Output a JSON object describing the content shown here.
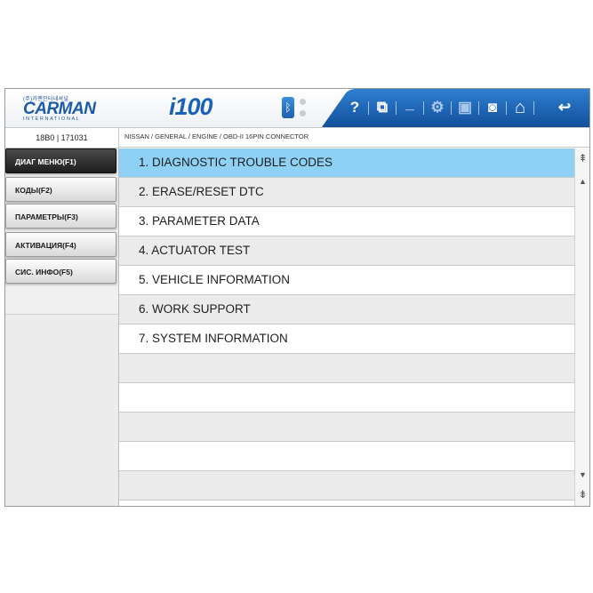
{
  "brand": {
    "korean": "(주)카맨인터내셔널",
    "name": "CARMAN",
    "sub": "INTERNATIONAL"
  },
  "model": "i100",
  "toolbar": {
    "help": "?",
    "window": "⧉",
    "minimize": "_",
    "settings": "⚙",
    "save": "▣",
    "camera": "◙",
    "home": "⌂",
    "back": "↩"
  },
  "status": {
    "vin": "18B0  |   171031",
    "path": "NISSAN / GENERAL / ENGINE / OBD-II 16PIN CONNECTOR"
  },
  "sidebar": {
    "items": [
      {
        "label": "ДИАГ МЕНЮ(F1)",
        "active": true
      },
      {
        "label": "КОДЫ(F2)",
        "active": false
      },
      {
        "label": "ПАРАМЕТРЫ(F3)",
        "active": false
      },
      {
        "label": "АКТИВАЦИЯ(F4)",
        "active": false
      },
      {
        "label": "СИС. ИНФО(F5)",
        "active": false
      }
    ]
  },
  "menu": {
    "items": [
      "1.  DIAGNOSTIC TROUBLE CODES",
      "2.  ERASE/RESET DTC",
      "3.  PARAMETER DATA",
      "4.  ACTUATOR TEST",
      "5.  VEHICLE INFORMATION",
      "6.  WORK SUPPORT",
      "7.  SYSTEM INFORMATION",
      "",
      "",
      "",
      "",
      ""
    ],
    "selected_index": 0
  },
  "scrollbar": {
    "top": "⇞",
    "up": "▲",
    "down": "▼",
    "bottom": "⇟"
  },
  "colors": {
    "accent": "#1a62b8",
    "selected_row": "#8fd0f5",
    "toolbar_blue": "#1f63b4"
  }
}
